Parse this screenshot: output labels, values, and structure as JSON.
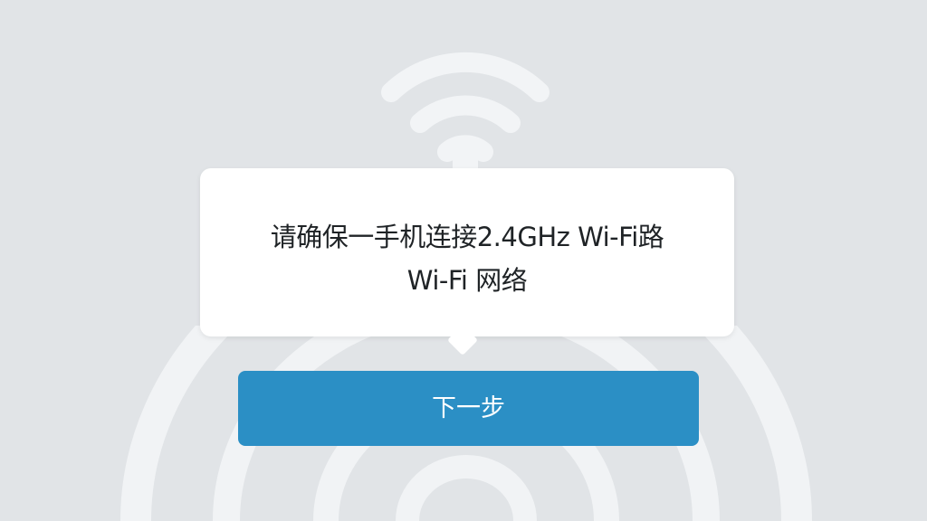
{
  "colors": {
    "background": "#e1e4e7",
    "popup_background": "#ffffff",
    "button_background": "#2b8fc5",
    "button_text": "#ffffff",
    "text_primary": "#1f2326",
    "background_wifi_icon": "#f2f4f6"
  },
  "popup": {
    "message_line1": "请确保一手机连接2.4GHz Wi-Fi路",
    "message_line2": "Wi-Fi 网络"
  },
  "actions": {
    "next_label": "下一步"
  },
  "icons": {
    "background_top": "wifi-icon",
    "background_bottom": "wifi-waves"
  }
}
